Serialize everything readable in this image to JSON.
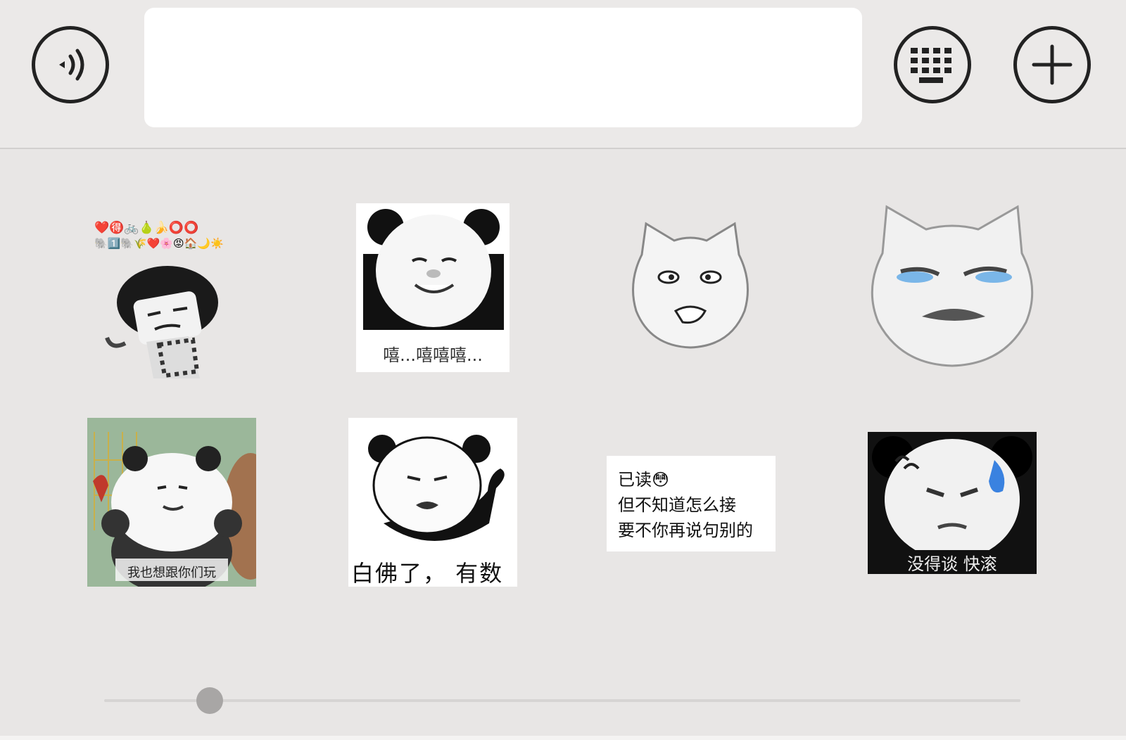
{
  "input_bar": {
    "voice_icon": "voice-wave-icon",
    "message_value": "",
    "keyboard_icon": "keyboard-icon",
    "plus_icon": "plus-icon"
  },
  "stickers": [
    {
      "id": 1,
      "caption": "",
      "emoji_rows": [
        "❤️🉐🚲🍐🍌⭕⭕",
        "🐘1️⃣🐘🌾❤️🌸😡🏠🌙☀️"
      ]
    },
    {
      "id": 2,
      "caption": "嘻...嘻嘻嘻..."
    },
    {
      "id": 3,
      "caption": ""
    },
    {
      "id": 4,
      "caption": ""
    },
    {
      "id": 5,
      "caption": "我也想跟你们玩"
    },
    {
      "id": 6,
      "caption": "白佛了， 有数"
    },
    {
      "id": 7,
      "lines": [
        "已读😳",
        "但不知道怎么接",
        "要不你再说句别的"
      ]
    },
    {
      "id": 8,
      "caption": "没得谈 快滚"
    }
  ],
  "page_slider": {
    "position_fraction": 0.11
  }
}
